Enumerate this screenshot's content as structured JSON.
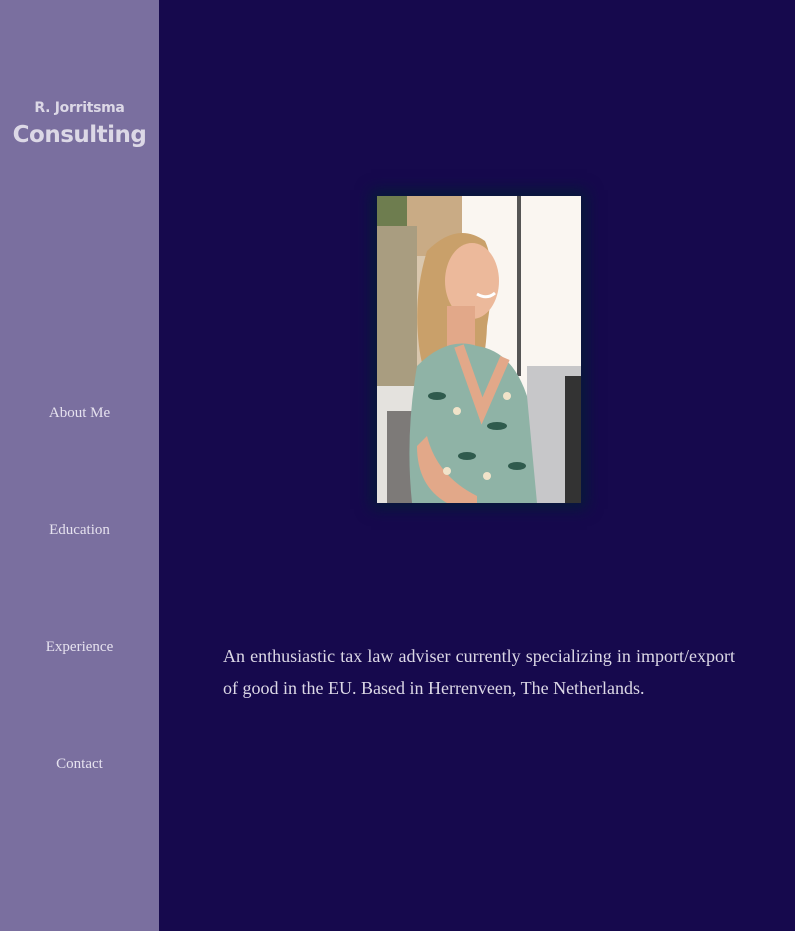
{
  "sidebar": {
    "brand_line1": "R. Jorritsma",
    "brand_line2": "Consulting",
    "nav": {
      "about": "About Me",
      "education": "Education",
      "experience": "Experience",
      "contact": "Contact"
    }
  },
  "main": {
    "bio": "An enthusiastic tax law adviser currently specializing in import/export of good in the EU. Based in Herrenveen, The Netherlands."
  },
  "colors": {
    "sidebar_bg": "#7a6f9f",
    "main_bg": "#16094d",
    "text": "#dcd8e6"
  }
}
